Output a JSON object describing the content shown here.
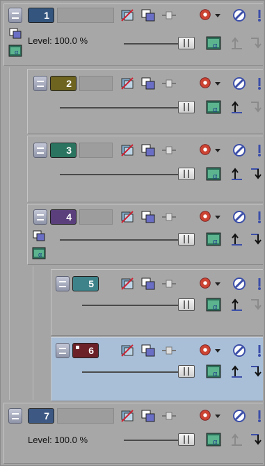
{
  "tracks": [
    {
      "number": "1",
      "color": "#34567e",
      "level_label": "Level: 100.0 %",
      "selected": false,
      "nesting": 0
    },
    {
      "number": "2",
      "color": "#6e6420",
      "selected": false,
      "nesting": 1
    },
    {
      "number": "3",
      "color": "#2b7560",
      "selected": false,
      "nesting": 1
    },
    {
      "number": "4",
      "color": "#5a3f7c",
      "selected": false,
      "nesting": 1
    },
    {
      "number": "5",
      "color": "#3e8389",
      "selected": false,
      "nesting": 2
    },
    {
      "number": "6",
      "color": "#6c2128",
      "selected": true,
      "nesting": 2
    },
    {
      "number": "7",
      "color": "#3c5883",
      "level_label": "Level: 100.0 %",
      "selected": false,
      "nesting": 0
    }
  ],
  "icons": {
    "track_fx": "track-fx-icon",
    "motion": "track-motion-icon",
    "compositing_mode": "compositing-mode-icon",
    "make_compositing_child": "compositing-child-icon",
    "automation": "automation-settings-icon",
    "mute": "mute-icon",
    "solo": "solo-icon",
    "compositing_parent": "make-compositing-parent-icon",
    "compositing_child": "make-compositing-child-icon",
    "alpha": "alpha-channel-icon",
    "parent_mode": "parent-composite-icon",
    "mask": "parent-mask-icon"
  },
  "colors": {
    "panel_bg": "#a5a5a5",
    "selected_bg": "#a9bfd8"
  }
}
